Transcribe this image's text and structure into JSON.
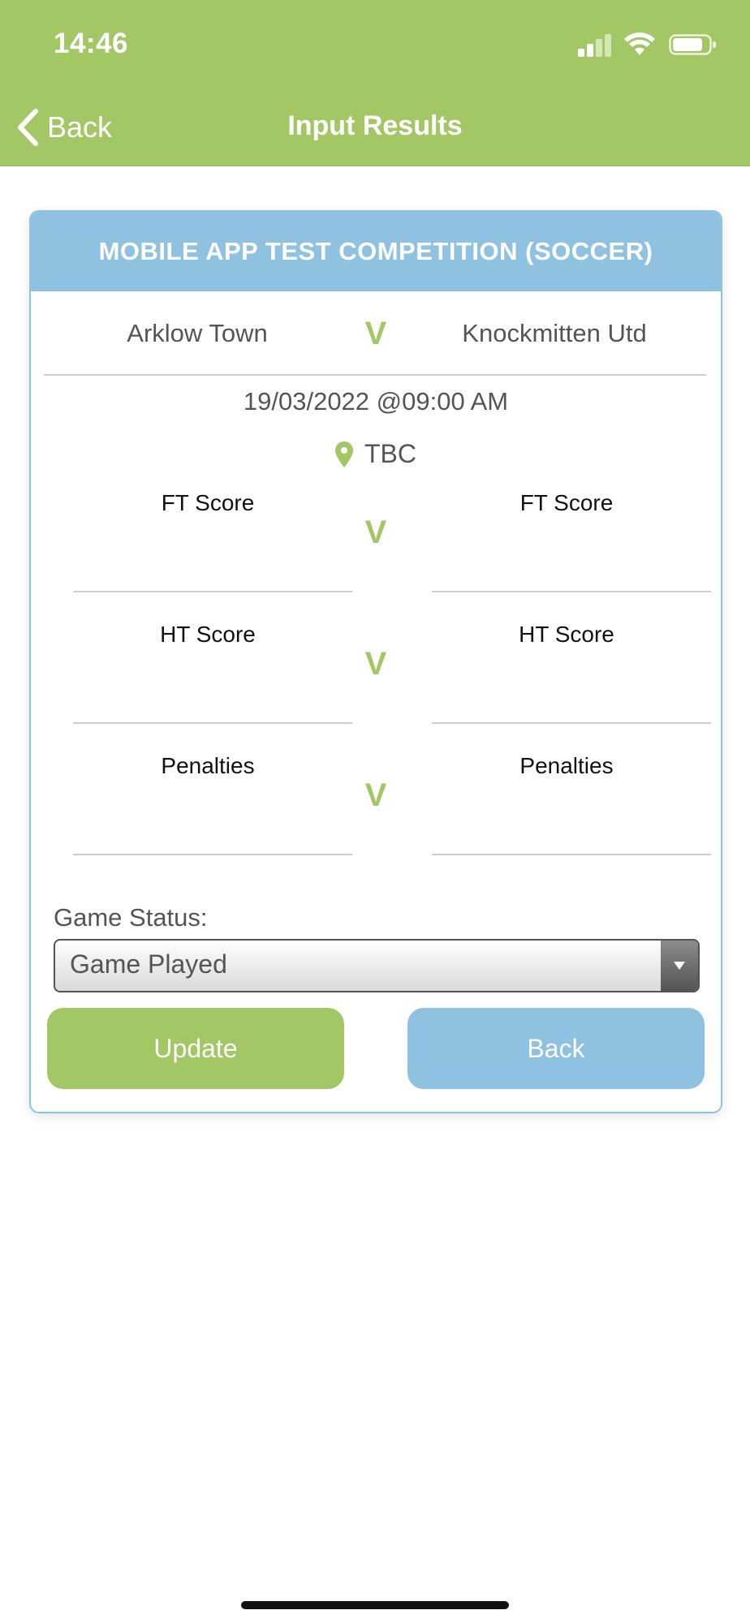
{
  "status_bar": {
    "time": "14:46"
  },
  "nav": {
    "back_label": "Back",
    "title": "Input Results"
  },
  "competition": {
    "name": "MOBILE APP TEST COMPETITION (SOCCER)"
  },
  "match": {
    "home_team": "Arklow Town",
    "away_team": "Knockmitten Utd",
    "versus": "V",
    "datetime": "19/03/2022 @09:00 AM",
    "venue": "TBC"
  },
  "scores": {
    "ft_label": "FT Score",
    "ht_label": "HT Score",
    "pen_label": "Penalties",
    "home_ft": "",
    "away_ft": "",
    "home_ht": "",
    "away_ht": "",
    "home_pen": "",
    "away_pen": ""
  },
  "game_status": {
    "label": "Game Status:",
    "selected": "Game Played"
  },
  "buttons": {
    "update": "Update",
    "back": "Back"
  },
  "colors": {
    "primary_green": "#a3c764",
    "accent_blue": "#8fc1e1"
  }
}
